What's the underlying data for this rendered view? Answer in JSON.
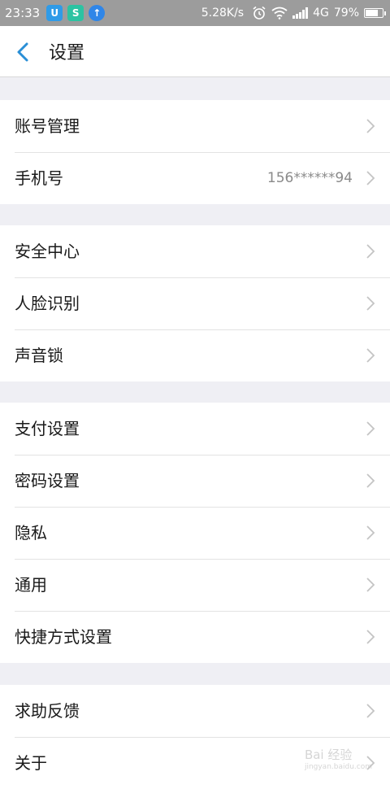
{
  "status_bar": {
    "time": "23:33",
    "app_icons": [
      "U",
      "S",
      "↑"
    ],
    "network_speed": "5.28K/s",
    "network_type": "4G",
    "battery": "79%",
    "battery_level": 0.79
  },
  "header": {
    "title": "设置",
    "back_icon": "chevron-left-icon",
    "accent_color": "#2a8fd6"
  },
  "groups": [
    {
      "items": [
        {
          "label": "账号管理",
          "value": ""
        },
        {
          "label": "手机号",
          "value": "156******94"
        }
      ]
    },
    {
      "items": [
        {
          "label": "安全中心",
          "value": ""
        },
        {
          "label": "人脸识别",
          "value": ""
        },
        {
          "label": "声音锁",
          "value": ""
        }
      ]
    },
    {
      "items": [
        {
          "label": "支付设置",
          "value": ""
        },
        {
          "label": "密码设置",
          "value": ""
        },
        {
          "label": "隐私",
          "value": ""
        },
        {
          "label": "通用",
          "value": ""
        },
        {
          "label": "快捷方式设置",
          "value": ""
        }
      ]
    },
    {
      "items": [
        {
          "label": "求助反馈",
          "value": ""
        },
        {
          "label": "关于",
          "value": ""
        }
      ]
    }
  ],
  "watermark": {
    "text": "Bai 经验",
    "sub": "jingyan.baidu.com"
  }
}
